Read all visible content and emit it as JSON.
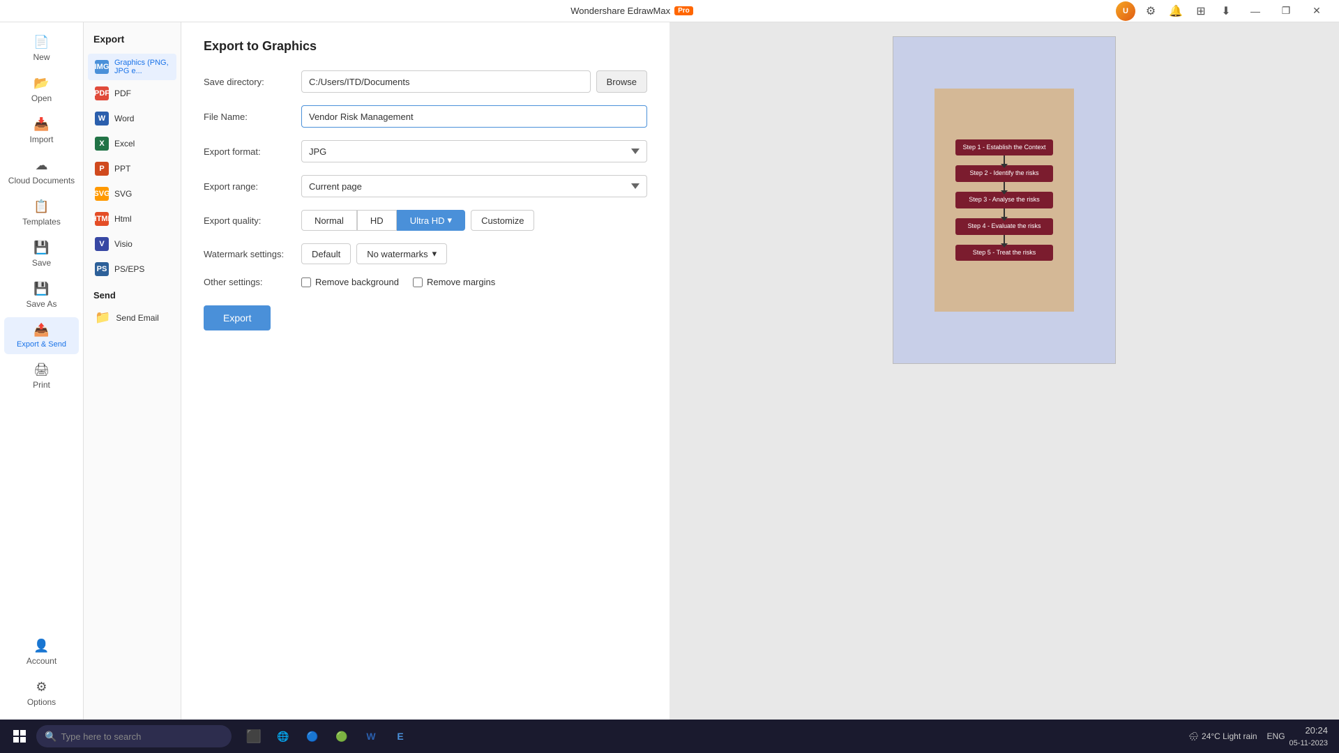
{
  "app": {
    "title": "Wondershare EdrawMax",
    "pro_badge": "Pro"
  },
  "titlebar": {
    "minimize": "—",
    "restore": "❐",
    "close": "✕",
    "icons": {
      "settings": "⚙",
      "bell": "🔔",
      "grid": "⊞",
      "download": "⬇"
    }
  },
  "sidebar": {
    "items": [
      {
        "label": "New",
        "icon": "＋"
      },
      {
        "label": "Open",
        "icon": "📂"
      },
      {
        "label": "Import",
        "icon": "📥"
      },
      {
        "label": "Cloud Documents",
        "icon": "☁"
      },
      {
        "label": "Templates",
        "icon": "📋"
      },
      {
        "label": "Save",
        "icon": "💾"
      },
      {
        "label": "Save As",
        "icon": "💾"
      },
      {
        "label": "Export & Send",
        "icon": "📤"
      },
      {
        "label": "Print",
        "icon": "🖨"
      }
    ],
    "bottom_items": [
      {
        "label": "Account",
        "icon": "👤"
      },
      {
        "label": "Options",
        "icon": "⚙"
      }
    ]
  },
  "secondary_sidebar": {
    "title": "Export",
    "items": [
      {
        "label": "Graphics (PNG, JPG e...",
        "type": "graphics",
        "active": true
      },
      {
        "label": "PDF",
        "type": "pdf"
      },
      {
        "label": "Word",
        "type": "word"
      },
      {
        "label": "Excel",
        "type": "excel"
      },
      {
        "label": "PPT",
        "type": "ppt"
      },
      {
        "label": "SVG",
        "type": "svg"
      },
      {
        "label": "Html",
        "type": "html"
      },
      {
        "label": "Visio",
        "type": "visio"
      },
      {
        "label": "PS/EPS",
        "type": "pseps"
      }
    ],
    "send_section": "Send",
    "send_items": [
      {
        "label": "Send Email",
        "icon": "📁"
      }
    ]
  },
  "export_form": {
    "title": "Export to Graphics",
    "save_directory_label": "Save directory:",
    "save_directory_value": "C:/Users/ITD/Documents",
    "browse_btn": "Browse",
    "file_name_label": "File Name:",
    "file_name_value": "Vendor Risk Management",
    "export_format_label": "Export format:",
    "export_format_value": "JPG",
    "export_range_label": "Export range:",
    "export_range_value": "Current page",
    "export_quality_label": "Export quality:",
    "quality_buttons": [
      "Normal",
      "HD",
      "Ultra HD"
    ],
    "active_quality": "Ultra HD",
    "customize_btn": "Customize",
    "watermark_label": "Watermark settings:",
    "watermark_default": "Default",
    "watermark_option": "No watermarks",
    "other_settings_label": "Other settings:",
    "remove_background": "Remove background",
    "remove_margins": "Remove margins",
    "export_btn": "Export"
  },
  "flowchart": {
    "steps": [
      "Step 1 - Establish the Context",
      "Step 2 - Identify the risks",
      "Step 3 - Analyse the risks",
      "Step 4 - Evaluate the risks",
      "Step 5 - Treat the risks"
    ]
  },
  "taskbar": {
    "search_placeholder": "Type here to search",
    "weather": "24°C  Light rain",
    "language": "ENG",
    "time": "20:24",
    "date": "05-11-2023"
  }
}
